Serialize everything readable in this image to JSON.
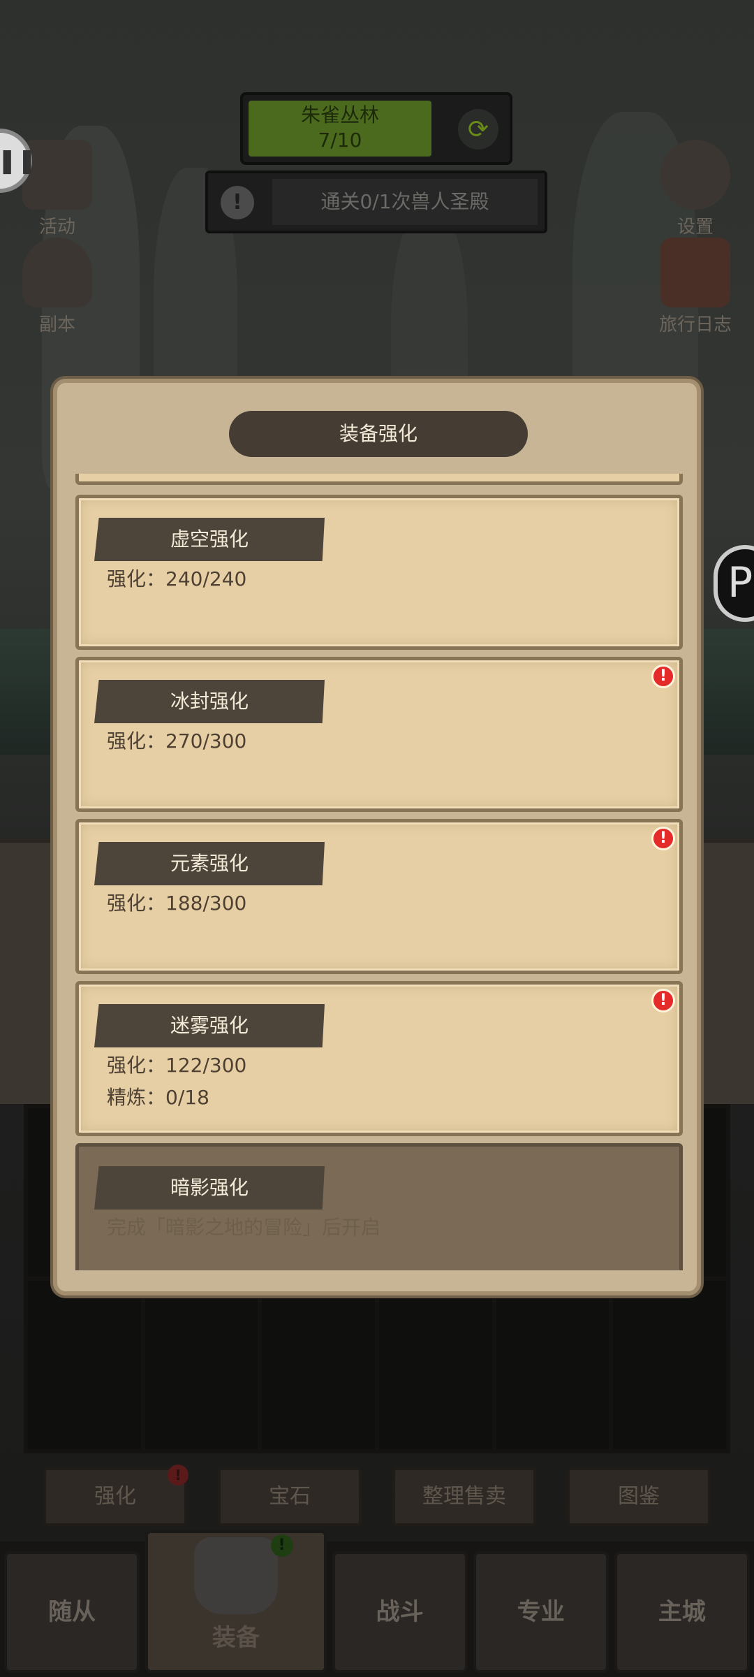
{
  "stage": {
    "name": "朱雀丛林",
    "progress": "7/10"
  },
  "quest": {
    "text": "通关0/1次兽人圣殿"
  },
  "side_buttons": {
    "activity": "活动",
    "dungeon": "副本",
    "settings": "设置",
    "travel_log": "旅行日志"
  },
  "modal": {
    "title": "装备强化",
    "cards": [
      {
        "title": "虚空强化",
        "lines": [
          "强化：240/240"
        ],
        "alert": false,
        "locked": false
      },
      {
        "title": "冰封强化",
        "lines": [
          "强化：270/300"
        ],
        "alert": true,
        "locked": false
      },
      {
        "title": "元素强化",
        "lines": [
          "强化：188/300"
        ],
        "alert": true,
        "locked": false
      },
      {
        "title": "迷雾强化",
        "lines": [
          "强化：122/300",
          "精炼：0/18"
        ],
        "alert": true,
        "locked": false
      },
      {
        "title": "暗影强化",
        "lines": [
          "完成「暗影之地的冒险」后开启"
        ],
        "alert": false,
        "locked": true
      }
    ]
  },
  "sub_tabs": [
    "强化",
    "宝石",
    "整理售卖",
    "图鉴"
  ],
  "bottom_nav": [
    "随从",
    "装备",
    "战斗",
    "专业",
    "主城"
  ],
  "icons": {
    "refresh": "refresh-icon",
    "alert": "alert-icon",
    "gear": "gear-icon"
  }
}
